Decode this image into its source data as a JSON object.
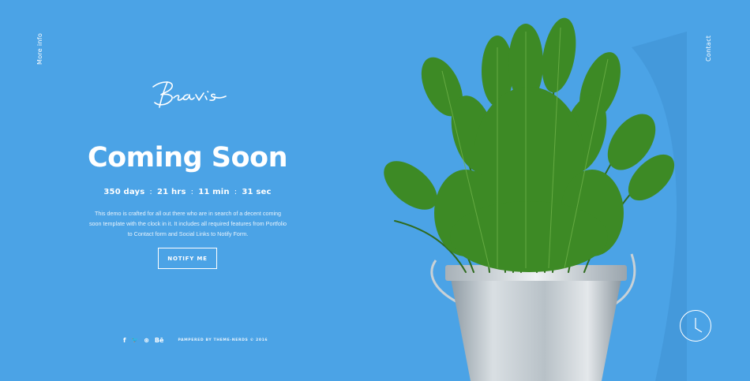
{
  "nav": {
    "more_info": "More info",
    "contact": "Contact"
  },
  "brand": {
    "logo_text": "Beavis"
  },
  "hero": {
    "title": "Coming Soon",
    "countdown": {
      "days": "350 days",
      "hours": "21 hrs",
      "minutes": "11 min",
      "seconds": "31 sec",
      "separator": ":"
    },
    "description": "This demo is crafted for all out there who are in search of a decent coming soon template with the clock in it. It includes all required features from Portfolio to Contact form and Social Links to Notify Form.",
    "notify_label": "NOTIFY ME"
  },
  "footer": {
    "social": [
      {
        "icon": "facebook-icon",
        "glyph": "f"
      },
      {
        "icon": "twitter-icon",
        "glyph": "🐦"
      },
      {
        "icon": "dribbble-icon",
        "glyph": "⊛"
      },
      {
        "icon": "behance-icon",
        "glyph": "Bē"
      }
    ],
    "credit": "PAMPERED BY THEME-NERDS © 2016"
  },
  "colors": {
    "background": "#4ba3e6",
    "text": "#ffffff"
  }
}
